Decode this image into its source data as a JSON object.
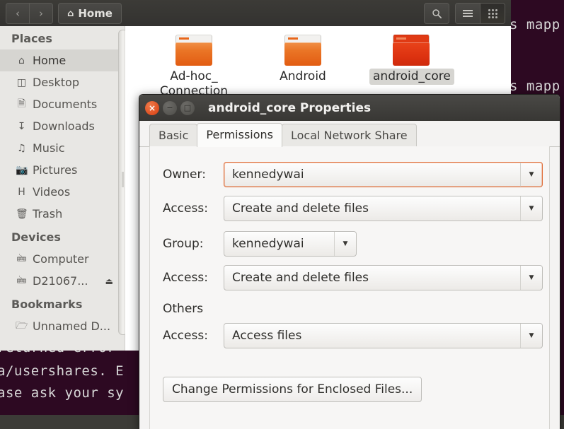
{
  "terminal": {
    "right_lines": [
      "s mapp",
      "s mapp"
    ],
    "left_lines": [
      "returned error",
      "a/usershares. E",
      "ase ask your sy"
    ]
  },
  "file_manager": {
    "toolbar": {
      "back_icon": "chevron-left-icon",
      "forward_icon": "chevron-right-icon",
      "home_label": "Home",
      "home_icon": "home-icon",
      "search_icon": "search-icon",
      "list_view_icon": "list-view-icon",
      "grid_view_icon": "grid-view-icon"
    },
    "sidebar": {
      "sections": [
        {
          "title": "Places",
          "items": [
            {
              "label": "Home",
              "icon": "home-icon",
              "glyph": "⌂",
              "selected": true
            },
            {
              "label": "Desktop",
              "icon": "folder-icon",
              "glyph": "◰",
              "selected": false
            },
            {
              "label": "Documents",
              "icon": "document-icon",
              "glyph": "὜E",
              "selected": false
            },
            {
              "label": "Downloads",
              "icon": "download-icon",
              "glyph": "↧",
              "selected": false
            },
            {
              "label": "Music",
              "icon": "music-icon",
              "glyph": "♫",
              "selected": false
            },
            {
              "label": "Pictures",
              "icon": "camera-icon",
              "glyph": "὏7",
              "selected": false
            },
            {
              "label": "Videos",
              "icon": "film-icon",
              "glyph": "ἹE",
              "selected": false
            },
            {
              "label": "Trash",
              "icon": "trash-icon",
              "glyph": "Ὕ1",
              "selected": false
            }
          ]
        },
        {
          "title": "Devices",
          "items": [
            {
              "label": "Computer",
              "icon": "computer-icon",
              "glyph": "὚E",
              "selected": false
            },
            {
              "label": "D21067...",
              "icon": "drive-icon",
              "glyph": "὚E",
              "selected": false,
              "eject": "⏏"
            }
          ]
        },
        {
          "title": "Bookmarks",
          "items": [
            {
              "label": "Unnamed D...",
              "icon": "network-folder-icon",
              "glyph": "Ὄ1",
              "selected": false
            }
          ]
        }
      ]
    },
    "files": [
      {
        "name": "Ad-hoc_\nConnection",
        "selected": false
      },
      {
        "name": "Android",
        "selected": false
      },
      {
        "name": "android_core",
        "selected": true
      }
    ]
  },
  "dialog": {
    "title": "android_core Properties",
    "window_buttons": {
      "close": "×",
      "minimize": "−",
      "maximize": "□"
    },
    "tabs": [
      {
        "label": "Basic",
        "active": false
      },
      {
        "label": "Permissions",
        "active": true
      },
      {
        "label": "Local Network Share",
        "active": false
      }
    ],
    "fields": {
      "owner_label": "Owner:",
      "owner_value": "kennedywai",
      "owner_access_label": "Access:",
      "owner_access_value": "Create and delete files",
      "group_label": "Group:",
      "group_value": "kennedywai",
      "group_access_label": "Access:",
      "group_access_value": "Create and delete files",
      "others_label": "Others",
      "others_access_label": "Access:",
      "others_access_value": "Access files"
    },
    "change_permissions_button": "Change Permissions for Enclosed Files...",
    "accent_focus_color": "#e0703c"
  }
}
